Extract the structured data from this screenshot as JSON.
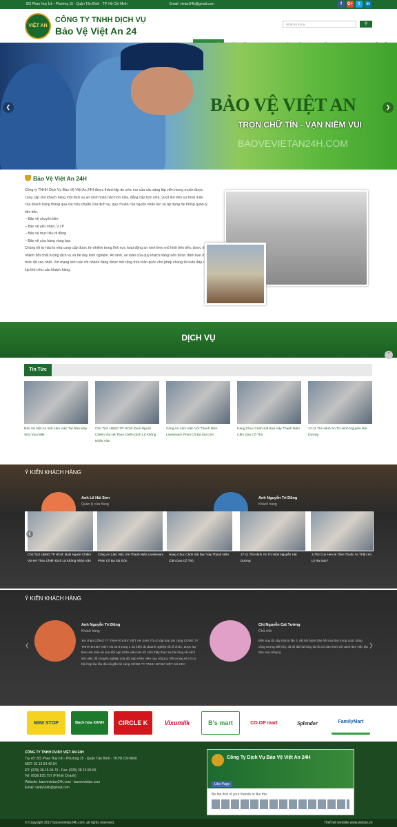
{
  "topbar": {
    "address": "8/3 Phan Huy Ích - Phường 15 - Quận Tân Bình - TP. Hồ Chí Minh",
    "email": "Email: vietan24h@gmail.com",
    "social": [
      "f",
      "G+",
      "t",
      "in"
    ]
  },
  "header": {
    "logo_text": "VIỆT AN",
    "company_line1": "CÔNG TY TNHH DỊCH VỤ",
    "company_line2": "Bảo Vệ Việt An 24",
    "search_placeholder": "Nhập từ khóa",
    "nav": [
      "TRANG CHỦ",
      "GIỚI THIỆU",
      "DỊCH VỤ",
      "KHÁCH HÀNG",
      "TIN TỨC",
      "TUYỂN DỤNG",
      "LIÊN HỆ"
    ]
  },
  "hero": {
    "title": "BẢO VỆ VIỆT AN",
    "slogan": "TRỌN CHỮ TÍN - VẠN NIỀM VUI",
    "watermark": "BAOVEVIETAN24H.COM"
  },
  "about": {
    "heading": "Bảo Vệ Việt An 24H",
    "paragraph1": "Công ty TNHH Dịch Vụ Bảo Vệ Việt An 24H được thành lập do ước mơ của các sáng lập viên mong muốn được cung cấp cho khách hàng một dịch vụ an ninh hoàn hảo hơn nữa, đẳng cấp hơn nữa, vượt lên trên sự thoả mãn của khách hàng thông qua các tiêu chuẩn của dịch vụ, quy chuẩn của nguồn nhân lực và áp dụng hệ thống quản lý tiên tiến.",
    "services": [
      "– Bảo vệ chuyên tiền",
      "– Bảo vệ yếu nhân, V.I.P",
      "– Bảo vệ mục tiêu di động",
      "– Bảo vệ cửa hàng vàng bạc"
    ],
    "paragraph2": "Chúng tôi tự hào là nhà cung cấp được tín nhiệm trong lĩnh vực hoạt động an ninh theo mô hình tiên tiến, được tín nhiệm bởi chất lượng dịch vụ và bề dày kinh nghiệm. An ninh, an toàn của quý khách hàng luôn được đảm bảo ở mức độ cao nhất. Với mạng lưới các chi nhánh đang được mở rộng trên toàn quốc cho phép chúng tôi luôn đáp ứng kịp thời nhu cầu khách hàng."
  },
  "dichvu": {
    "title": "DỊCH VỤ"
  },
  "news": {
    "tab": "Tin Tức",
    "items": [
      "Bảo Vệ Việt An 24h Làm Việc Tại Nhà Máy Sữa Vixu Milk",
      "Chủ Tịch UBND TP HCM: Đuổi Người Chiếm Vỉa Hè Theo Chiến Dịch Là Không Nhân Văn",
      "Công An Làm Việc Với Thanh Niên Livestream Phim Cô Ba Sài Gòn",
      "Hàng Chục Cảnh Sát Bao Vây Thanh Niên Cầm Dao Cố Thủ",
      "17-11 Thi Hành Án Tử Hình Nguyễn Hải Dương"
    ]
  },
  "ykien1": {
    "title": "Ý KIẾN KHÁCH HÀNG",
    "people": [
      {
        "name": "Anh Lê Hải Sơn",
        "role": "Quản lý cửa hàng"
      },
      {
        "name": "Anh Nguyễn Trí Dũng",
        "role": "Khách hàng"
      }
    ],
    "strip": [
      "Chủ Tịch UBND TP HCM: Đuổi Người Chiếm Vỉa Hè Theo Chiến Dịch Là Không Nhân Văn",
      "Công An Làm Việc Với Thanh Niên Livestream Phim Cô Ba Sài Gòn",
      "Hàng Chục Cảnh Sát Bao Vây Thanh Niên Cầm Dao Cố Thủ",
      "17-11 Thi Hành Án Tử Hình Nguyễn Hải Dương",
      "3.750 Con Heo Bị Tiêm Thuốc An Thần Xử Lý Ra Sao?"
    ]
  },
  "ykien2": {
    "title": "Ý KIẾN KHÁCH HÀNG",
    "people": [
      {
        "name": "Anh Nguyễn Trí Dũng",
        "role": "Khách hàng",
        "quote": "Xin chào CÔNG TY TNHH DV.BV VIỆT AN 24H! Tôi có dịp hợp tác cùng CÔNG TY TNHH DV.BV VIỆT AN 24H trong 1 sự kiện do doanh nghiệp tôi tổ chức, được sự theo sát, bảo vệ của đội ngũ nhân viên làm tôi cảm thấy thực sự hài lòng về cách làm việc rất chuyên nghiệp của đội ngũ nhân viên của công ty. Rất mong sẽ có cơ hội hợp tác lâu dài và gắn bó cùng CÔNG TY TNHH DV.BV VIỆT AN 24H!"
      },
      {
        "name": "Chị Nguyễn Cát Tường",
        "role": "Chủ nhà",
        "quote": "Đến nay tôi xây nhà là lần 3, để hài hoàn hảo hết mọi thứ trong cuộc sống công tương đối khó, xã tôi đã hài lòng và rất có cảm tình với cách làm việc tận tâm của công ty."
      }
    ]
  },
  "partners": [
    "MINI STOP",
    "Bách hóa XANH",
    "CIRCLE K",
    "Vixumilk",
    "B's mart",
    "CO.OP mart",
    "Splendor",
    "FamilyMart"
  ],
  "footer": {
    "company": "CÔNG TY TNHH DV.BV VIỆT AN 24H",
    "lines": [
      "Trụ sở: 8/3 Phan Huy Ích - Phường 15 - Quận Tân Bình - TP.Hồ Chí Minh",
      "MST: 03.12.64.42.64",
      "ĐT: (028) 38.15.94.79 - Fax: (028) 38.15.95.69",
      "Tel: 0936.835.797 (P.Kinh Doanh)",
      "Website: baovevietan24h.com - baovevietan.com",
      "Email: vietan24h@gmail.com"
    ],
    "fb_page": "Công Ty Dịch Vụ Bảo Vệ Việt An 24H",
    "fb_like": "Like Page",
    "fb_friends": "Be the first of your friends to like this",
    "copyright": "© Copyright 2017 baovevietan24h.com, all rights reserved.",
    "design": "Thiết kế website www.webso.vn"
  },
  "colors": {
    "brand_green": "#1d6b2f",
    "nav_active": "#2e8b3d",
    "gold": "#d4a020"
  }
}
